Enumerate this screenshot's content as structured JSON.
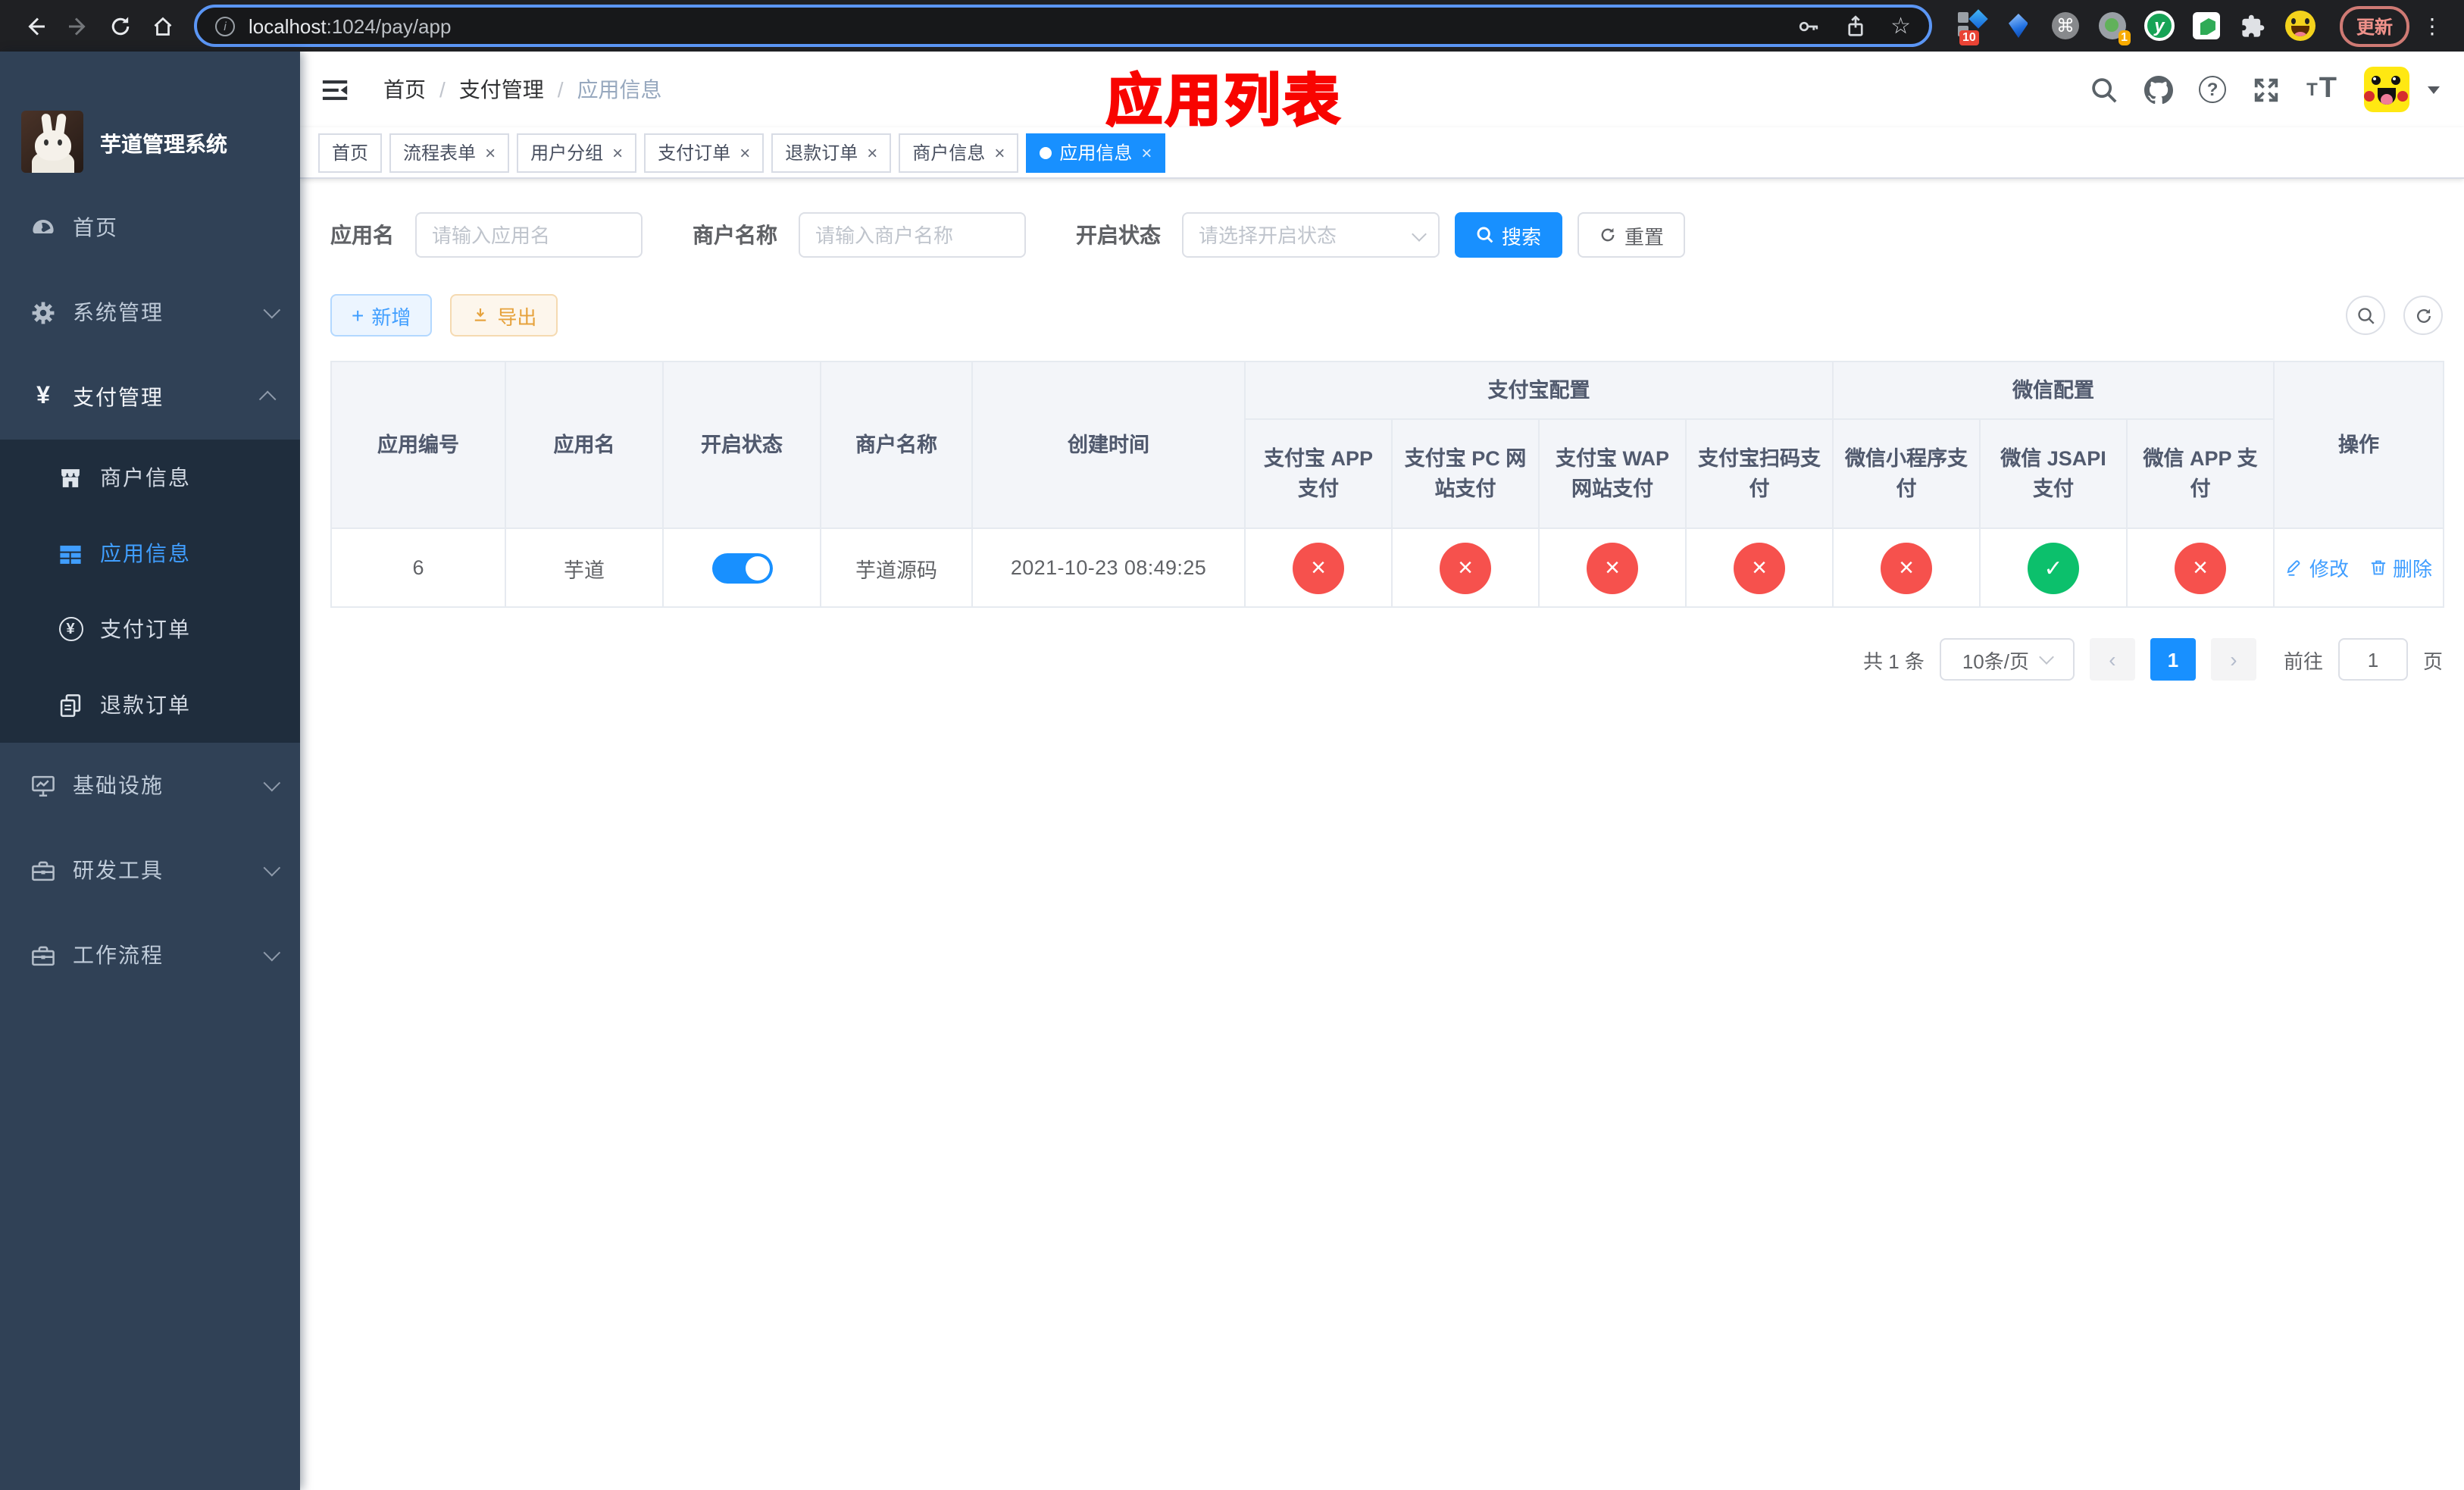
{
  "browser": {
    "url_host": "localhost",
    "url_rest": ":1024/pay/app",
    "ext_badge_blue": "10",
    "ext_badge_camera": "1",
    "update_button": "更新"
  },
  "sidebar": {
    "title": "芋道管理系统",
    "menu": [
      {
        "label": "首页",
        "icon": "dashboard-icon",
        "expanded": null
      },
      {
        "label": "系统管理",
        "icon": "gear-icon",
        "expanded": false
      },
      {
        "label": "支付管理",
        "icon": "yen-icon",
        "expanded": true
      }
    ],
    "submenu": [
      {
        "label": "商户信息",
        "icon": "shop-icon",
        "active": false
      },
      {
        "label": "应用信息",
        "icon": "grid-icon",
        "active": true
      },
      {
        "label": "支付订单",
        "icon": "coin-icon",
        "active": false
      },
      {
        "label": "退款订单",
        "icon": "documents-icon",
        "active": false
      }
    ],
    "menu2": [
      {
        "label": "基础设施",
        "icon": "monitor-icon",
        "expanded": false
      },
      {
        "label": "研发工具",
        "icon": "toolbox-icon",
        "expanded": false
      },
      {
        "label": "工作流程",
        "icon": "toolbox-icon",
        "expanded": false
      }
    ]
  },
  "header": {
    "breadcrumb": [
      "首页",
      "支付管理",
      "应用信息"
    ],
    "overlay_title": "应用列表"
  },
  "tabs": [
    {
      "label": "首页",
      "closable": false,
      "active": false
    },
    {
      "label": "流程表单",
      "closable": true,
      "active": false
    },
    {
      "label": "用户分组",
      "closable": true,
      "active": false
    },
    {
      "label": "支付订单",
      "closable": true,
      "active": false
    },
    {
      "label": "退款订单",
      "closable": true,
      "active": false
    },
    {
      "label": "商户信息",
      "closable": true,
      "active": false
    },
    {
      "label": "应用信息",
      "closable": true,
      "active": true
    }
  ],
  "filters": {
    "app_name_label": "应用名",
    "app_name_placeholder": "请输入应用名",
    "merchant_label": "商户名称",
    "merchant_placeholder": "请输入商户名称",
    "status_label": "开启状态",
    "status_placeholder": "请选择开启状态",
    "search_button": "搜索",
    "reset_button": "重置"
  },
  "toolbar": {
    "add_button": "新增",
    "export_button": "导出"
  },
  "table": {
    "plain_columns": [
      "应用编号",
      "应用名",
      "开启状态",
      "商户名称",
      "创建时间"
    ],
    "alipay_group": "支付宝配置",
    "alipay_columns": [
      "支付宝 APP 支付",
      "支付宝 PC 网站支付",
      "支付宝 WAP 网站支付",
      "支付宝扫码支付"
    ],
    "wechat_group": "微信配置",
    "wechat_columns": [
      "微信小程序支付",
      "微信 JSAPI 支付",
      "微信 APP 支付"
    ],
    "actions_column": "操作",
    "rows": [
      {
        "app_id": "6",
        "app_name": "芋道",
        "enabled": true,
        "merchant_name": "芋道源码",
        "create_time": "2021-10-23 08:49:25",
        "statuses": [
          "no",
          "no",
          "no",
          "no",
          "no",
          "yes",
          "no"
        ],
        "edit_label": "修改",
        "delete_label": "删除"
      }
    ]
  },
  "pagination": {
    "total_text": "共 1 条",
    "page_size_text": "10条/页",
    "current_page": "1",
    "goto_label": "前往",
    "goto_value": "1",
    "page_unit": "页"
  },
  "colors": {
    "accent_blue": "#1890ff",
    "link_blue": "#409eff",
    "danger_red": "#f6514d",
    "success_green": "#0cc06c",
    "sidebar_bg": "#304156",
    "submenu_bg": "#1f2d3d",
    "annotation_red": "#f80400"
  }
}
